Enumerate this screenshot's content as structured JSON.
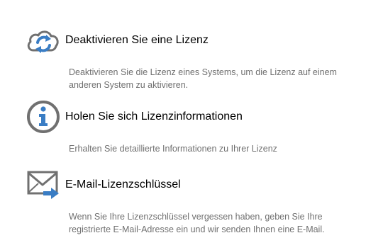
{
  "options": [
    {
      "icon": "cloud-sync-icon",
      "title": "Deaktivieren Sie eine Lizenz",
      "description": "Deaktivieren Sie die Lizenz eines Systems, um die Lizenz auf einem anderen System zu aktivieren."
    },
    {
      "icon": "info-icon",
      "title": "Holen Sie sich Lizenzinformationen",
      "description": "Erhalten Sie detaillierte Informationen zu Ihrer Lizenz"
    },
    {
      "icon": "mail-forward-icon",
      "title": "E-Mail-Lizenzschlüssel",
      "description": "Wenn Sie Ihre Lizenzschlüssel vergessen haben, geben Sie Ihre registrierte E-Mail-Adresse ein und wir senden Ihnen eine E-Mail."
    }
  ],
  "colors": {
    "icon_gray": "#707070",
    "icon_blue": "#3a7dc4",
    "title_text": "#000000",
    "description_text": "#707070"
  }
}
